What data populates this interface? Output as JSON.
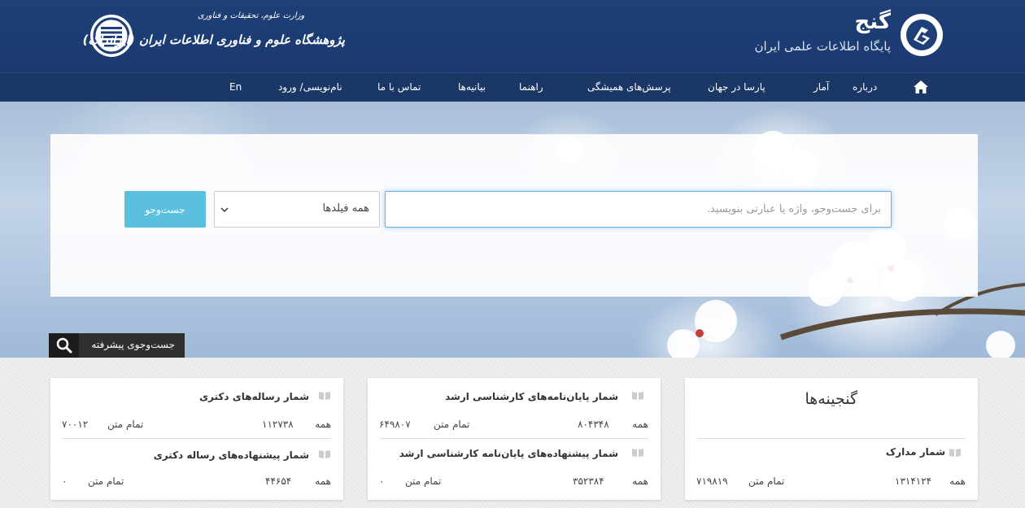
{
  "header": {
    "site_title": "گنج",
    "site_subtitle": "پایگاه اطلاعات علمی ایران",
    "org_ministry": "وزارت علوم، تحقیقات و فناوری",
    "org_name": "پژوهشگاه علوم و فناوری اطلاعات ایران (ایرانداک)"
  },
  "nav": {
    "home_icon": "home-icon",
    "items": [
      "درباره",
      "آمار",
      "پارسا در جهان",
      "پرسش‌های همیشگی",
      "راهنما",
      "بیانیه‌ها",
      "تماس با ما",
      "نام‌نویسی/ ورود",
      "En"
    ]
  },
  "search": {
    "placeholder": "برای جست‌وجو، واژه یا عبارتی بنویسید.",
    "field_selected": "همه فیلدها",
    "button_label": "جست‌وجو",
    "advanced_label": "جست‌وجوی پیشرفته"
  },
  "cards": {
    "treasures": {
      "heading": "گنجینه‌ها",
      "title": "شمار مدارک",
      "all_label": "همه",
      "all_value": "۱۳۱۴۱۲۴",
      "fulltext_label": "تمام متن",
      "fulltext_value": "۷۱۹۸۱۹"
    },
    "masters": {
      "title1": "شمار پایان‌نامه‌های کارشناسی ارشد",
      "all_label1": "همه",
      "all_value1": "۸۰۴۳۴۸",
      "fulltext_label1": "تمام متن",
      "fulltext_value1": "۶۴۹۸۰۷",
      "title2": "شمار پیشنهاده‌های پایان‌نامه کارشناسی ارشد",
      "all_label2": "همه",
      "all_value2": "۳۵۲۳۸۴",
      "fulltext_label2": "تمام متن",
      "fulltext_value2": "۰"
    },
    "doctoral": {
      "title1": "شمار رساله‌های دکتری",
      "all_label1": "همه",
      "all_value1": "۱۱۲۷۳۸",
      "fulltext_label1": "تمام متن",
      "fulltext_value1": "۷۰۰۱۲",
      "title2": "شمار پیشنهاده‌های رساله دکتری",
      "all_label2": "همه",
      "all_value2": "۴۴۶۵۴",
      "fulltext_label2": "تمام متن",
      "fulltext_value2": "۰"
    }
  },
  "colors": {
    "header_bg": "#1f3f78",
    "nav_bg": "#1b3766",
    "search_button": "#5bc0de",
    "advanced_bg": "#2f2f2f"
  }
}
